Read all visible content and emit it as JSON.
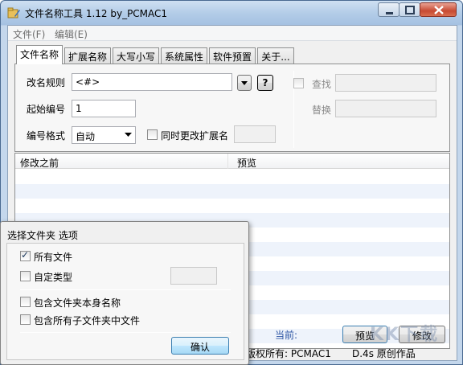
{
  "window": {
    "title": "文件名称工具 1.12  by_PCMAC1",
    "icon": "folder-pencil-icon"
  },
  "menu": {
    "items": [
      "文件(F)",
      "编辑(E)"
    ]
  },
  "tabs": [
    "文件名称",
    "扩展名称",
    "大写小写",
    "系统属性",
    "软件预置",
    "关于..."
  ],
  "active_tab": "文件名称",
  "form": {
    "rename_rule_label": "改名规则",
    "rename_rule_value": "<#>",
    "help_button": "?",
    "start_number_label": "起始编号",
    "start_number_value": "1",
    "number_format_label": "编号格式",
    "number_format_value": "自动",
    "change_ext_label": "同时更改扩展名",
    "find_label": "查找",
    "replace_label": "替换"
  },
  "list": {
    "columns": [
      "修改之前",
      "预览"
    ]
  },
  "status": {
    "current_label": "当前:",
    "preview_button": "预览",
    "modify_button": "修改",
    "copyright": "版权所有: PCMAC1",
    "original": "D.4s 原创作品"
  },
  "popup": {
    "title": "选择文件夹 选项",
    "all_files": "所有文件",
    "all_files_checked": true,
    "custom_type": "自定类型",
    "include_folder_name": "包含文件夹本身名称",
    "include_subfolder_files": "包含所有子文件夹中文件",
    "ok_button": "确认"
  },
  "watermark": "KK下载"
}
